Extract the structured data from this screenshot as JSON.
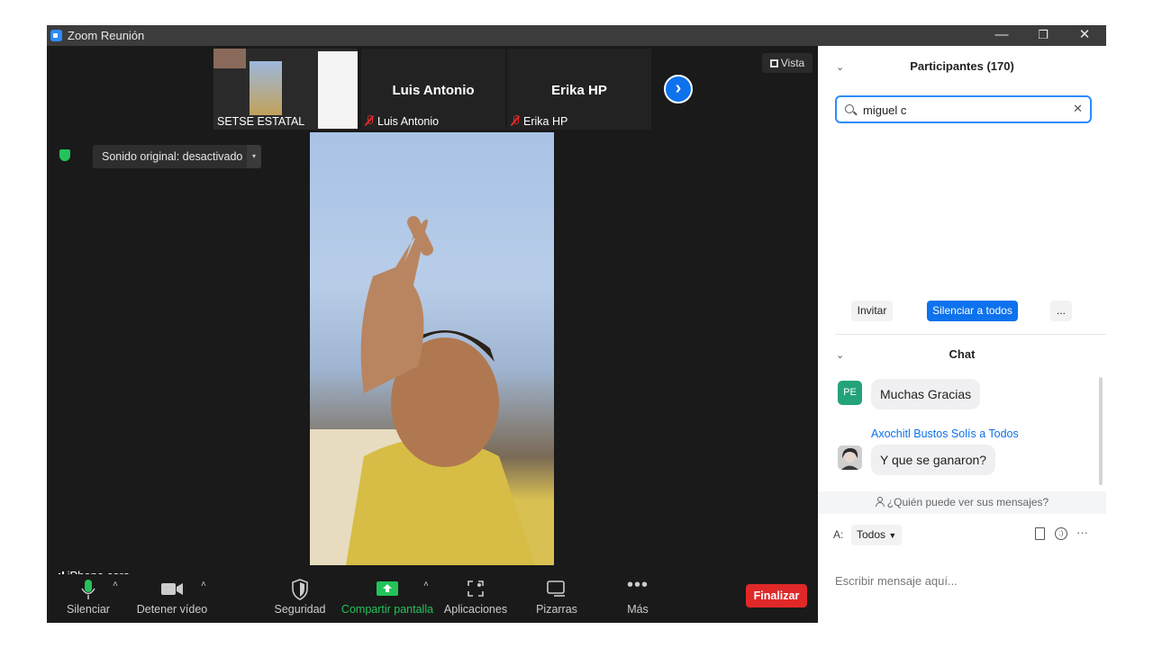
{
  "window": {
    "title": "Zoom Reunión",
    "minimize": "—",
    "restore": "❐",
    "close": "✕"
  },
  "strip": {
    "tiles": [
      {
        "name": "SETSE ESTATAL"
      },
      {
        "name": "Luis Antonio",
        "display": "Luis Antonio",
        "muted": true
      },
      {
        "name": "Erika HP",
        "display": "Erika HP",
        "muted": true
      }
    ],
    "next": "›",
    "view_label": "Vista"
  },
  "video": {
    "original_sound": "Sonido original: desactivado",
    "caret": "▾",
    "speaker": "iPhone coro"
  },
  "toolbar": {
    "mute": "Silenciar",
    "stop_video": "Detener vídeo",
    "security": "Seguridad",
    "share": "Compartir pantalla",
    "apps": "Aplicaciones",
    "whiteboards": "Pizarras",
    "more": "Más",
    "end": "Finalizar",
    "caret": "˄"
  },
  "participants": {
    "title": "Participantes (170)",
    "search_value": "miguel c",
    "invite": "Invitar",
    "mute_all": "Silenciar a todos",
    "more": "..."
  },
  "chat": {
    "title": "Chat",
    "messages": [
      {
        "avatar": "PE",
        "sender": "",
        "text": "Muchas Gracias"
      },
      {
        "avatar": "",
        "sender": "Axochitl Bustos Solís a Todos",
        "text": "Y que se ganaron?"
      }
    ],
    "who_sees": "¿Quién puede ver sus mensajes?",
    "to_label": "A:",
    "to_value": "Todos",
    "placeholder": "Escribir mensaje aquí...",
    "more": "···"
  },
  "colors": {
    "accent": "#2d8cff",
    "end_red": "#e02828",
    "share_green": "#23c35a",
    "avatar_pe": "#23a37b",
    "sender_blue": "#0e71eb"
  }
}
